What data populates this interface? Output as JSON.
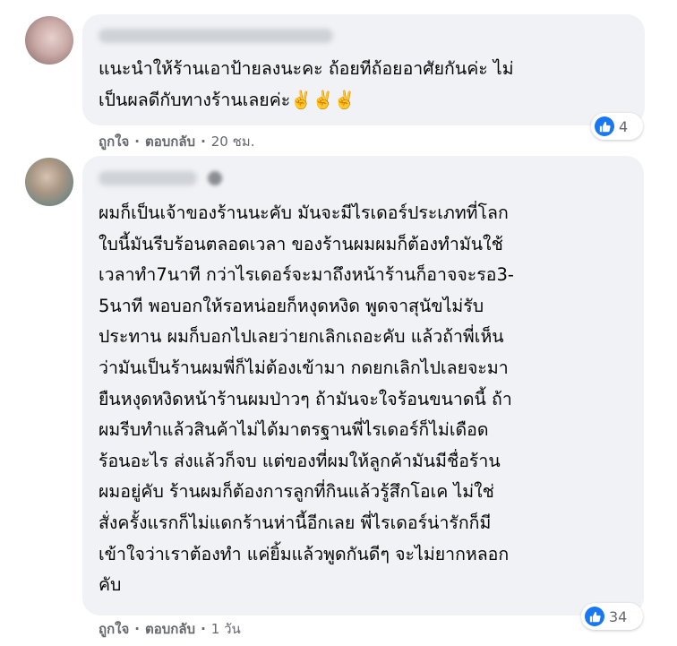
{
  "colors": {
    "bubble": "#f0f2f5",
    "meta_text": "#65676b",
    "like_blue": "#1877f2"
  },
  "comments": [
    {
      "text_lines": [
        "แนะนำให้ร้านเอาป้ายลงนะคะ ถ้อยทีถ้อยอาศัยกันค่ะ ไม่",
        "เป็นผลดีกับทางร้านเลยค่ะ✌️✌️✌️"
      ],
      "reaction_count": "4",
      "like_label": "ถูกใจ",
      "reply_label": "ตอบกลับ",
      "time": "20 ชม."
    },
    {
      "text_lines": [
        "ผมก็เป็นเจ้าของร้านนะคับ มันจะมีไรเดอร์ประเภทที่โลก",
        "ใบนี้มันรีบร้อนตลอดเวลา ของร้านผมผมก็ต้องทำมันใช้",
        "เวลาทำ7นาที กว่าไรเดอร์จะมาถึงหน้าร้านก็อาจจะรอ3-",
        "5นาที พอบอกให้รอหน่อยก็หงุดหงิด พูดจาสุนัขไม่รับ",
        "ประทาน ผมก็บอกไปเลยว่ายกเลิกเถอะคับ แล้วถ้าพี่เห็น",
        "ว่ามันเป็นร้านผมพี่ก็ไม่ต้องเข้ามา กดยกเลิกไปเลยจะมา",
        "ยืนหงุดหงิดหน้าร้านผมป่าวๆ ถ้ามันจะใจร้อนขนาดนี้ ถ้า",
        "ผมรีบทำแล้วสินค้าไม่ได้มาตรฐานพี่ไรเดอร์ก็ไม่เดือด",
        "ร้อนอะไร ส่งแล้วก็จบ แต่ของที่ผมให้ลูกค้ามันมีชื่อร้าน",
        "ผมอยู่คับ ร้านผมก็ต้องการลูกที่กินแล้วรู้สึกโอเค ไม่ใช่",
        "สั่งครั้งแรกก็ไม่แดกร้านห่านี้อีกเลย พี่ไรเดอร์น่ารักก็มี",
        "เข้าใจว่าเราต้องทำ แค่ยิ้มแล้วพูดกันดีๆ จะไม่ยากหลอก",
        "คับ"
      ],
      "reaction_count": "34",
      "like_label": "ถูกใจ",
      "reply_label": "ตอบกลับ",
      "time": "1 วัน"
    }
  ]
}
